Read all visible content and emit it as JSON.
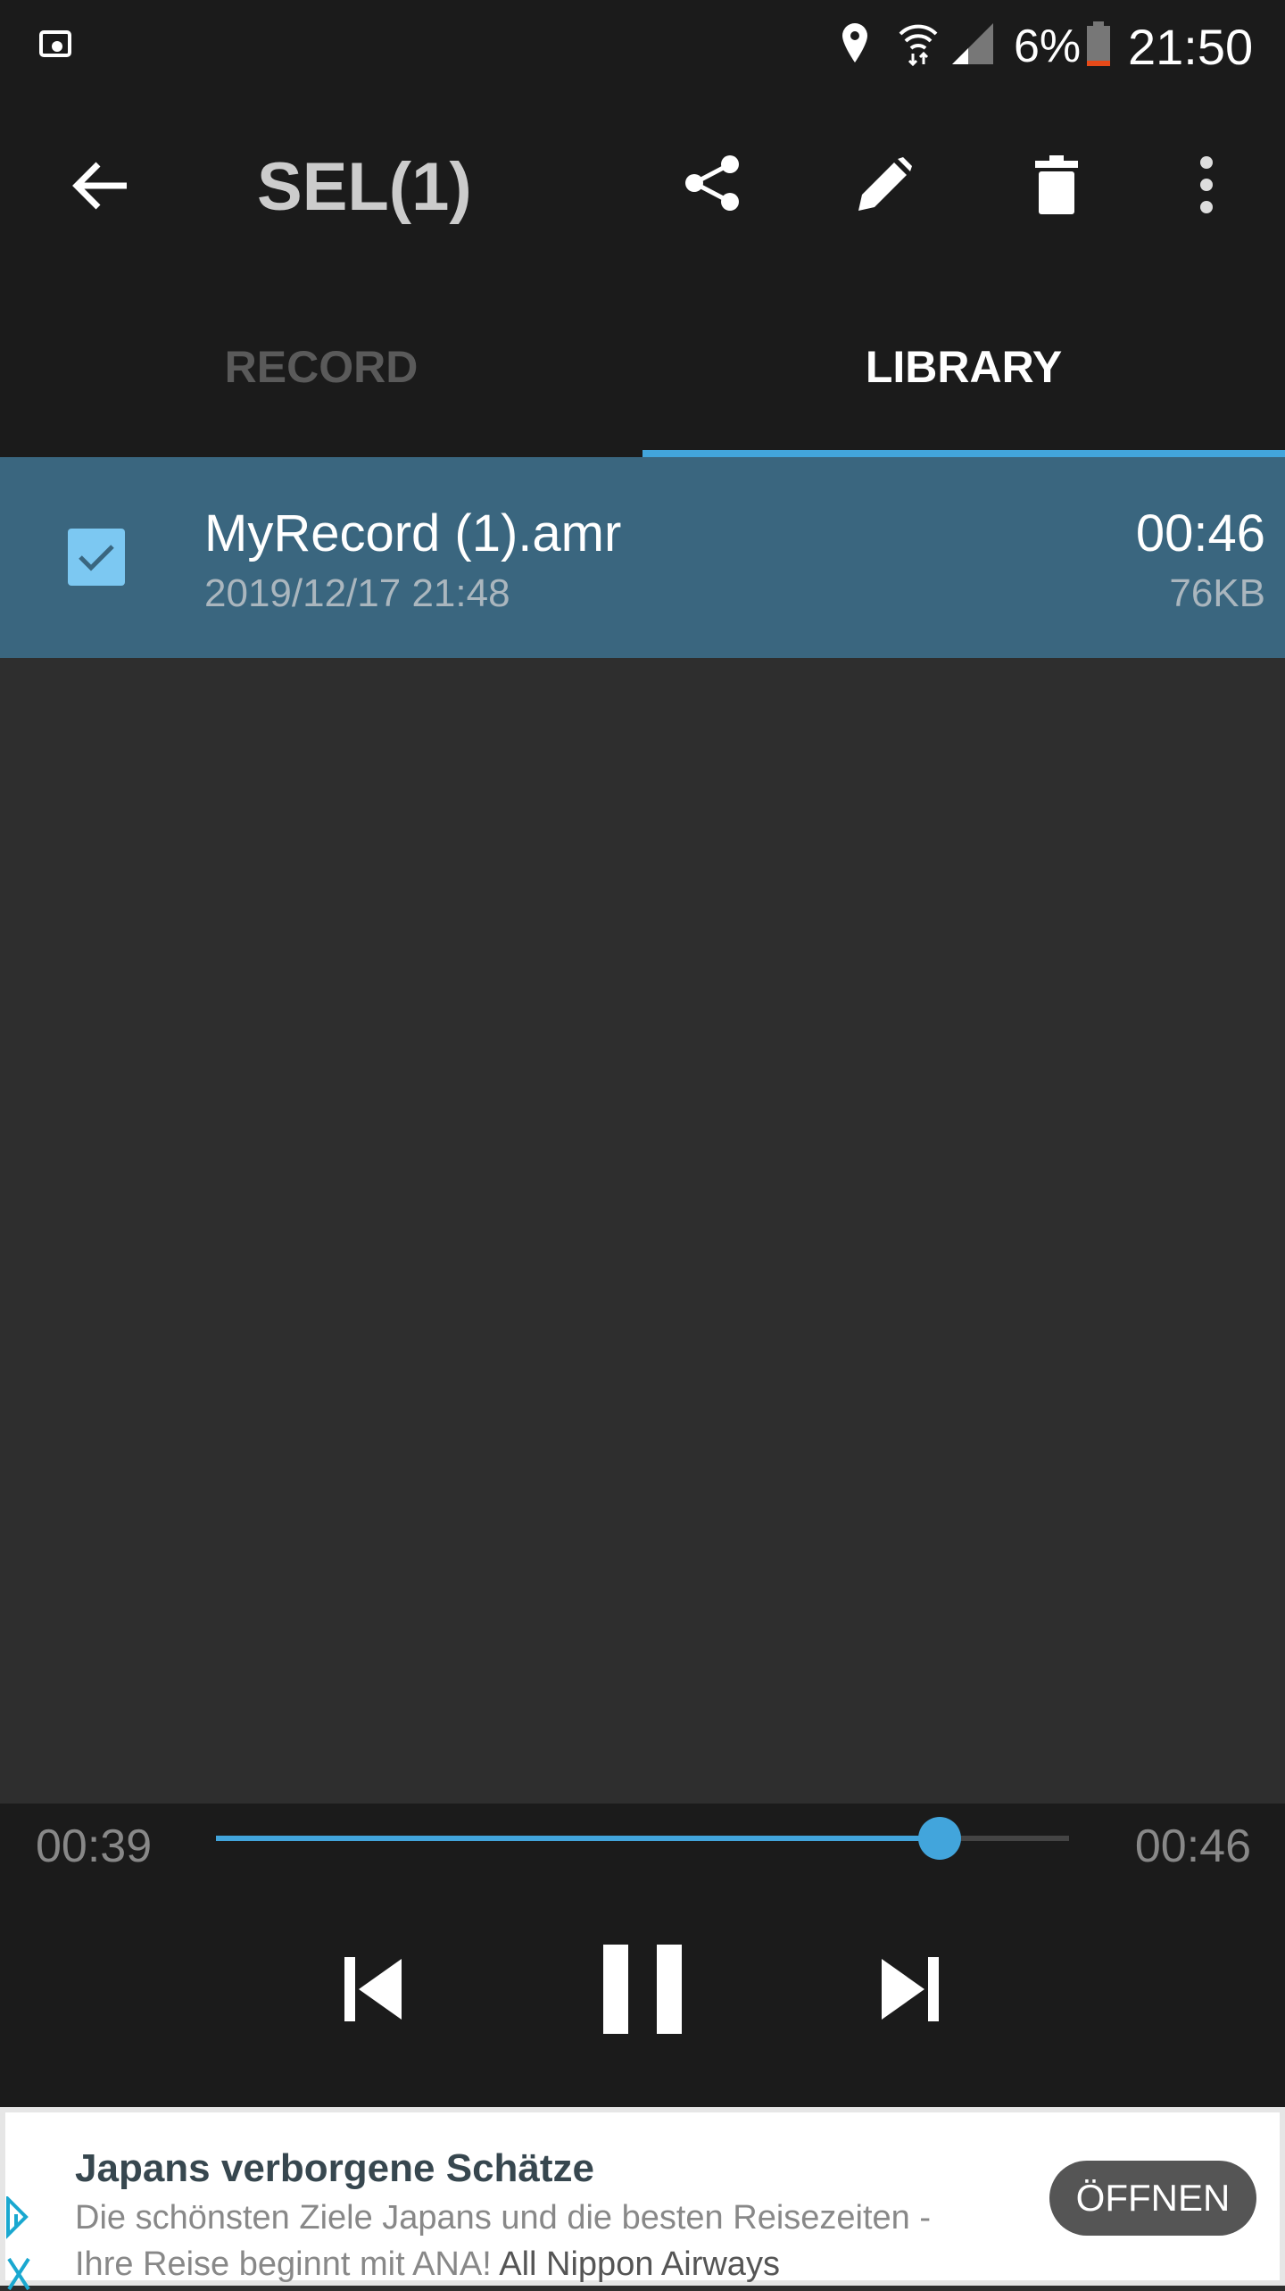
{
  "status_bar": {
    "battery": "6%",
    "time": "21:50"
  },
  "toolbar": {
    "title": "SEL(1)"
  },
  "tabs": [
    {
      "label": "RECORD",
      "active": false
    },
    {
      "label": "LIBRARY",
      "active": true
    }
  ],
  "recordings": [
    {
      "name": "MyRecord (1).amr",
      "date": "2019/12/17 21:48",
      "duration": "00:46",
      "size": "76KB",
      "selected": true
    }
  ],
  "player": {
    "elapsed": "00:39",
    "total": "00:46",
    "progress": 0.848,
    "state": "playing"
  },
  "ad": {
    "title": "Japans verborgene Schätze",
    "body": "Die schönsten Ziele Japans und die besten Reisezeiten - Ihre Reise beginnt mit ANA!",
    "advertiser": "All Nippon Airways",
    "cta": "ÖFFNEN"
  },
  "colors": {
    "accent": "#42a5dc",
    "selected_row": "#3a667f",
    "bar_bg": "#1b1b1b",
    "list_bg": "#2e2e2e"
  }
}
